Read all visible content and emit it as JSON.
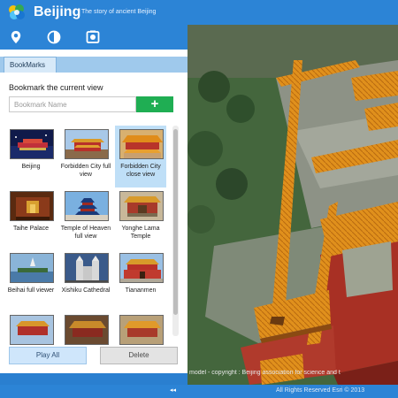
{
  "app": {
    "title": "Beijing",
    "subtitle": "The story of ancient Beijing"
  },
  "toolbar": {
    "tools": [
      {
        "icon": "location-pin-icon"
      },
      {
        "icon": "contrast-icon"
      },
      {
        "icon": "camera-icon"
      }
    ]
  },
  "bookmarks": {
    "tab_label": "BookMarks",
    "prompt": "Bookmark the current view",
    "name_placeholder": "Bookmark Name",
    "add_label": "+",
    "items": [
      {
        "label": "Beijing",
        "selected": false
      },
      {
        "label": "Forbidden City full view",
        "selected": false
      },
      {
        "label": "Forbidden City close view",
        "selected": true
      },
      {
        "label": "Taihe Palace",
        "selected": false
      },
      {
        "label": "Temple of Heaven full view",
        "selected": false
      },
      {
        "label": "Yonghe Lama Temple",
        "selected": false
      },
      {
        "label": "Beihai full viewer",
        "selected": false
      },
      {
        "label": "Xishiku Cathedral",
        "selected": false
      },
      {
        "label": "Tiananmen",
        "selected": false
      },
      {
        "label": "",
        "selected": false
      },
      {
        "label": "",
        "selected": false
      },
      {
        "label": "",
        "selected": false
      }
    ],
    "play_all_label": "Play All",
    "delete_label": "Delete"
  },
  "map": {
    "credit": "model - copyright : Beijing association for science and t"
  },
  "footer": {
    "collapse_label": "◂◂",
    "rights": "All Rights Reserved Esri © 2013"
  },
  "colors": {
    "header": "#2c84d6",
    "accent_green": "#1fae53",
    "selected": "#bfdff7",
    "roof_orange": "#e08c1a"
  }
}
